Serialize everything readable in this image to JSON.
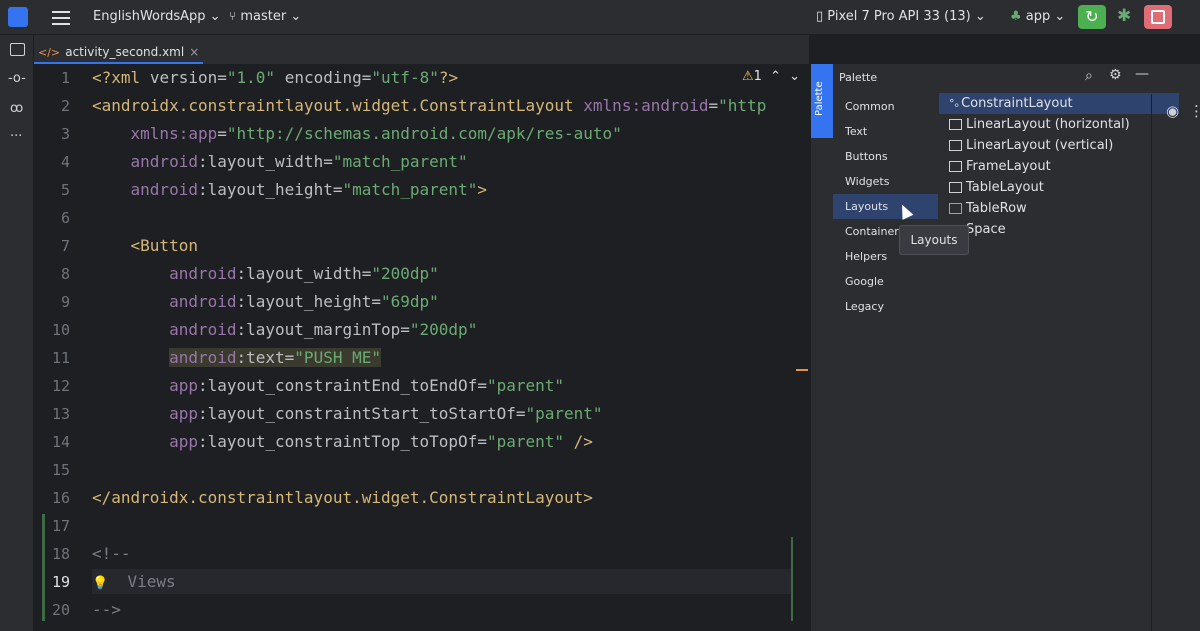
{
  "topbar": {
    "project": "EnglishWordsApp",
    "branch": "master",
    "device": "Pixel 7 Pro API 33 (13)",
    "run_config": "app"
  },
  "tab": {
    "label": "activity_second.xml",
    "close": "×"
  },
  "editor": {
    "warnings": "1",
    "lines": [
      "1",
      "2",
      "3",
      "4",
      "5",
      "6",
      "7",
      "8",
      "9",
      "10",
      "11",
      "12",
      "13",
      "14",
      "15",
      "16",
      "17",
      "18",
      "19",
      "20"
    ]
  },
  "palette": {
    "title": "Palette",
    "strip_label": "Palette",
    "categories": [
      "Common",
      "Text",
      "Buttons",
      "Widgets",
      "Layouts",
      "Containers",
      "Helpers",
      "Google",
      "Legacy"
    ],
    "selected_category": "Layouts",
    "items": [
      "ConstraintLayout",
      "LinearLayout (horizontal)",
      "LinearLayout (vertical)",
      "FrameLayout",
      "TableLayout",
      "TableRow",
      "Space"
    ],
    "tooltip": "Layouts"
  },
  "colors": {
    "run_button": "#4caf50",
    "stop_button": "#e06c75",
    "accent": "#3574f0"
  }
}
